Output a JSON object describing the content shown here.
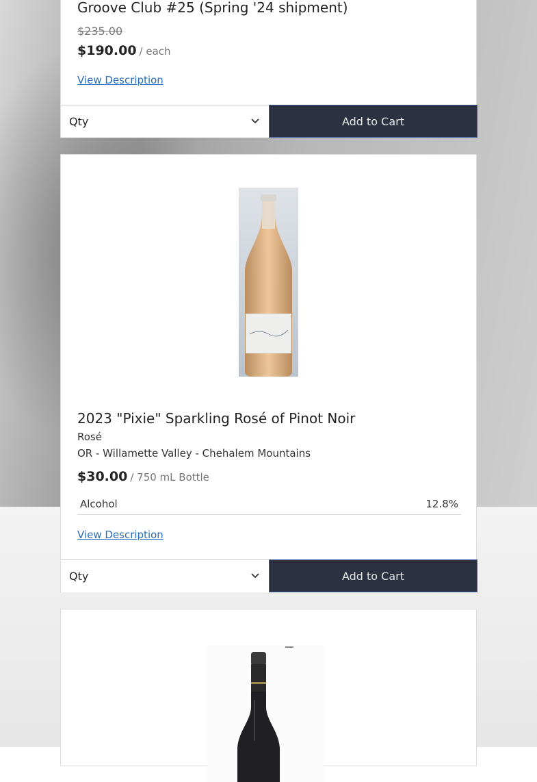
{
  "products": [
    {
      "name": "Groove Club #25 (Spring '24 shipment)",
      "original_price": "$235.00",
      "price": "$190.00",
      "unit": "/ each",
      "view_label": "View Description",
      "qty_label": "Qty",
      "add_label": "Add to Cart"
    },
    {
      "name": "2023 \"Pixie\" Sparkling Rosé of Pinot Noir",
      "type": "Rosé",
      "region": "OR - Willamette Valley - Chehalem Mountains",
      "price": "$30.00",
      "unit": "/ 750 mL Bottle",
      "attributes": [
        {
          "label": "Alcohol",
          "value": "12.8%"
        }
      ],
      "view_label": "View Description",
      "qty_label": "Qty",
      "add_label": "Add to Cart",
      "image_icon": "rose-wine-bottle-photo"
    },
    {
      "image_icon": "red-wine-bottle-photo"
    }
  ],
  "colors": {
    "button_bg": "#2b3140",
    "link": "#2a6cb8",
    "button_border": "#3b5fa8"
  }
}
